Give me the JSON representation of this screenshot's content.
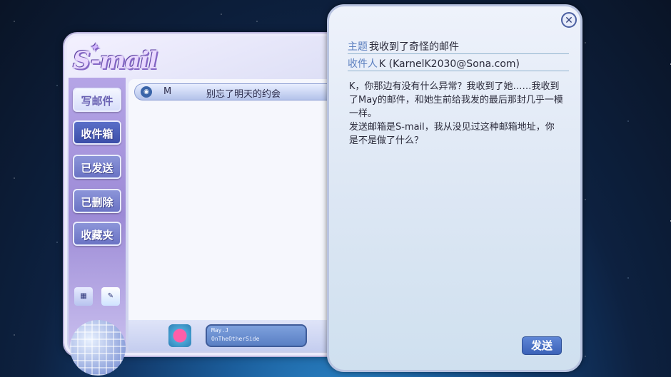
{
  "app": {
    "logo_text": "S-mail"
  },
  "sidebar": {
    "items": [
      {
        "label": "写邮件"
      },
      {
        "label": "收件箱"
      },
      {
        "label": "已发送"
      },
      {
        "label": "已删除"
      },
      {
        "label": "收藏夹"
      }
    ]
  },
  "inbox": {
    "rows": [
      {
        "sender": "M",
        "subject": "别忘了明天的约会"
      }
    ]
  },
  "user": {
    "name": "May.J",
    "subtitle": "OnTheOtherSide"
  },
  "message": {
    "subject_label": "主题",
    "subject": "我收到了奇怪的邮件",
    "recipient_label": "收件人",
    "recipient": "K (KarnelK2030@Sona.com)",
    "body": [
      "K，你那边有没有什么异常？我收到了她……我收到了May的邮件，和她生前给我发的最后那封几乎一模一样。",
      "发送邮箱是S-mail，我从没见过这种邮箱地址，你是不是做了什么？"
    ],
    "send_label": "发送",
    "close_symbol": "✕"
  }
}
